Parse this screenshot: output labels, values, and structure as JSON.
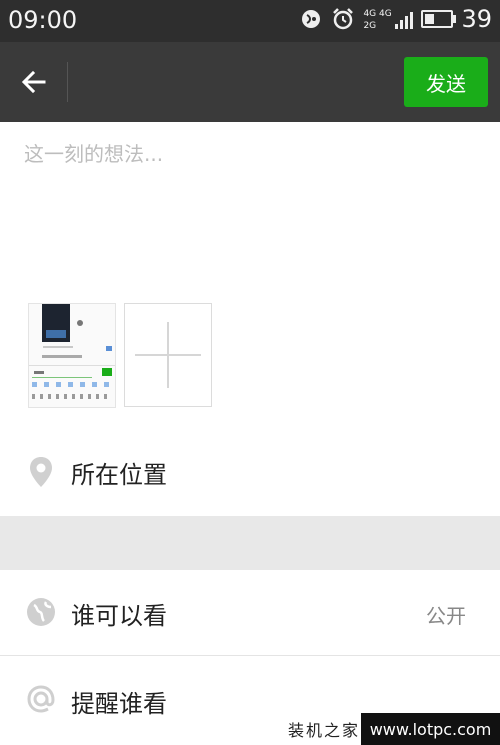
{
  "status_bar": {
    "time": "09:00",
    "network_top": "4G 4G",
    "network_bottom": "2G",
    "battery_text": "39",
    "battery_level": 0.39,
    "icons": [
      "nfc-icon",
      "alarm-icon",
      "signal-icon",
      "battery-icon"
    ]
  },
  "toolbar": {
    "back_icon": "arrow-left-icon",
    "send_label": "发送",
    "accent_color": "#1aad19"
  },
  "composer": {
    "placeholder": "这一刻的想法..."
  },
  "photos": {
    "add_icon": "plus-icon"
  },
  "location": {
    "label": "所在位置",
    "icon": "location-pin-icon"
  },
  "visibility": {
    "label": "谁可以看",
    "value": "公开",
    "icon": "globe-icon"
  },
  "remind": {
    "label": "提醒谁看",
    "icon": "at-sign-icon"
  },
  "watermark": {
    "chinese": "装机之家",
    "url": "www.lotpc.com"
  }
}
